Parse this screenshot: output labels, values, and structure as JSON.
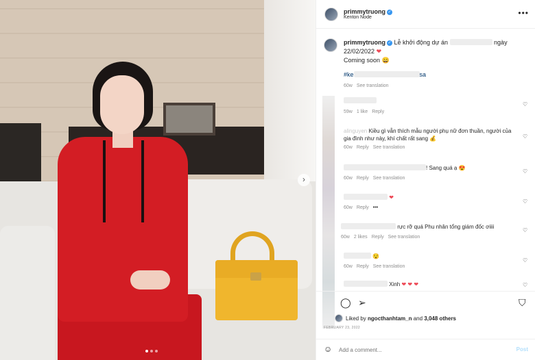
{
  "post": {
    "username": "primmytruong",
    "location": "Kenton Node",
    "more_label": "•••"
  },
  "caption": {
    "username": "primmytruong",
    "text_a": "Lễ khởi động dự án",
    "text_b": "ngày",
    "date_line": "22/02/2022",
    "coming_soon": "Coming soon",
    "hashtag_start": "#ke",
    "hashtag_end": "sa",
    "time": "60w",
    "see_translation": "See translation"
  },
  "comments": [
    {
      "text": "",
      "time": "59w",
      "likes": "1 like",
      "reply": "Reply",
      "translate": ""
    },
    {
      "text": "Kiều gì vẫn thích mẫu người phụ nữ đơn thuần, người của gia đình như này, khí chất rất sang",
      "prefix": "alinguyen",
      "time": "60w",
      "likes": "",
      "reply": "Reply",
      "translate": "See translation"
    },
    {
      "text": "! Sang quá ạ",
      "time": "60w",
      "likes": "",
      "reply": "Reply",
      "translate": "See translation"
    },
    {
      "text": "",
      "time": "60w",
      "likes": "",
      "reply": "Reply",
      "translate": ""
    },
    {
      "text": "rực rỡ quá Phu nhân tổng giám đốc ơiiii",
      "time": "60w",
      "likes": "2 likes",
      "reply": "Reply",
      "translate": "See translation"
    },
    {
      "text": "",
      "time": "60w",
      "likes": "",
      "reply": "Reply",
      "translate": "See translation"
    },
    {
      "text": "Xinh",
      "time": "",
      "likes": "",
      "reply": "",
      "translate": ""
    }
  ],
  "likes": {
    "prefix": "Liked by",
    "user": "ngocthanhtam_n",
    "and": "and",
    "count": "3,048 others"
  },
  "date": "FEBRUARY 23, 2022",
  "add_comment": {
    "placeholder": "Add a comment...",
    "post_label": "Post"
  },
  "icons": [
    "heart-icon",
    "comment-icon",
    "share-icon",
    "bookmark-icon",
    "emoji-icon",
    "verified-icon",
    "carousel-next-icon"
  ],
  "colors": {
    "verified": "#3897f0",
    "heart": "#ed4956",
    "hashtag": "#00376b",
    "post_disabled": "#b2dffc"
  }
}
